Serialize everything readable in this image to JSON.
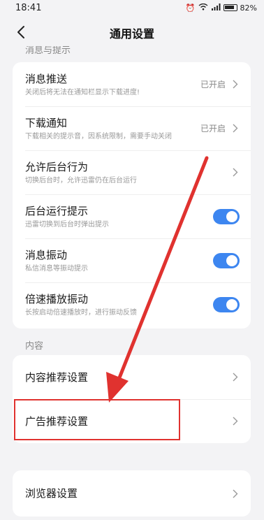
{
  "status_bar": {
    "time": "18:41",
    "battery_text": "82%"
  },
  "header": {
    "title": "通用设置"
  },
  "sections": {
    "messages_label": "消息与提示",
    "content_label": "内容"
  },
  "messages": [
    {
      "title": "消息推送",
      "sub": "关闭后将无法在通知栏显示下载进度!",
      "state": "已开启",
      "control": "chevron"
    },
    {
      "title": "下载通知",
      "sub": "下载相关的提示音，因系统限制，需要手动关闭",
      "state": "已开启",
      "control": "chevron"
    },
    {
      "title": "允许后台行为",
      "sub": "切换后台时，允许迅雷仍在后台运行",
      "state": "",
      "control": "chevron"
    },
    {
      "title": "后台运行提示",
      "sub": "迅雷切换到后台时弹出提示",
      "state": "",
      "control": "toggle-on"
    },
    {
      "title": "消息振动",
      "sub": "私信消息等振动提示",
      "state": "",
      "control": "toggle-on"
    },
    {
      "title": "倍速播放振动",
      "sub": "长按启动倍速播放时，进行振动反馈",
      "state": "",
      "control": "toggle-on"
    }
  ],
  "content": [
    {
      "title": "内容推荐设置"
    },
    {
      "title": "广告推荐设置"
    }
  ],
  "other": [
    {
      "title": "浏览器设置"
    }
  ],
  "colors": {
    "accent": "#3d86f0",
    "annotation": "#e0322f"
  }
}
